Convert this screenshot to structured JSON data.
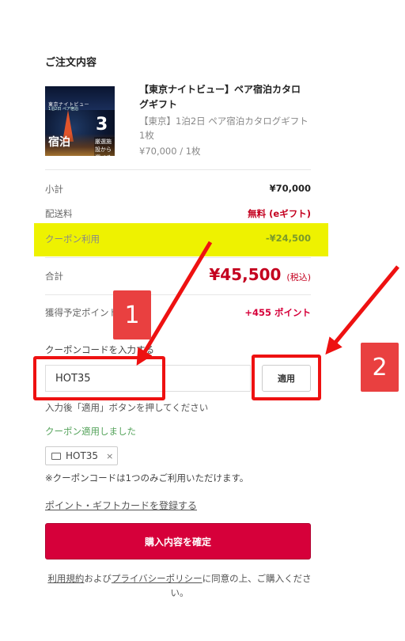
{
  "order": {
    "section_title": "ご注文内容",
    "product": {
      "name": "【東京ナイトビュー】ペア宿泊カタログギフト",
      "description": "【東京】1泊2日 ペア宿泊カタログギフト 1枚",
      "price": "¥70,000 / 1枚",
      "thumbnail_text": {
        "line1": "東京ナイトビュー",
        "line2": "1泊2日 ペア宿泊",
        "big": "3",
        "kanji": "宿泊",
        "sub": "厳選施設から選べる"
      }
    }
  },
  "summary": {
    "subtotal_label": "小計",
    "subtotal_value": "¥70,000",
    "shipping_label": "配送料",
    "shipping_value": "無料 (eギフト)",
    "coupon_label": "クーポン利用",
    "coupon_value": "-¥24,500",
    "total_label": "合計",
    "total_value": "¥45,500",
    "total_tax": "(税込)",
    "points_label": "獲得予定ポイント",
    "points_value": "+455 ポイント"
  },
  "coupon": {
    "input_label": "クーポンコードを入力する",
    "input_value": "HOT35",
    "apply_label": "適用",
    "help_text": "入力後「適用」ボタンを押してください",
    "success_text": "クーポン適用しました",
    "chip_code": "HOT35",
    "chip_remove": "×",
    "note": "※クーポンコードは1つのみご利用いただけます。"
  },
  "gift_link": "ポイント・ギフトカードを登録する",
  "confirm_button": "購入内容を確定",
  "terms": {
    "terms_link": "利用規約",
    "and": "および",
    "privacy_link": "プライバシーポリシー",
    "suffix": "に同意の上、ご購入ください。"
  },
  "annotations": {
    "callout1": "1",
    "callout2": "2",
    "highlight_color": "#eef200",
    "arrow_color": "#ee1111"
  },
  "colors": {
    "accent": "#d6003a",
    "price_red": "#c4001f",
    "success_green": "#55a35b"
  }
}
